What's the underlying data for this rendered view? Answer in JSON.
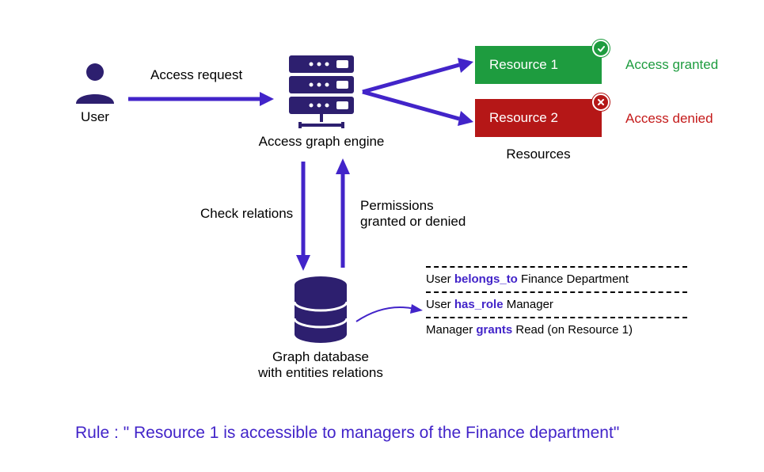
{
  "nodes": {
    "user": {
      "label": "User"
    },
    "engine": {
      "label": "Access graph engine"
    },
    "resources_group": {
      "label": "Resources"
    },
    "resource1": {
      "label": "Resource 1",
      "status": "Access granted"
    },
    "resource2": {
      "label": "Resource 2",
      "status": "Access denied"
    },
    "db": {
      "label_l1": "Graph database",
      "label_l2": "with entities relations"
    }
  },
  "edges": {
    "access_request": "Access request",
    "check_relations": "Check relations",
    "permissions_l1": "Permissions",
    "permissions_l2": "granted or denied"
  },
  "relations": {
    "r1_pre": "User ",
    "r1_kw": "belongs_to",
    "r1_post": " Finance Department",
    "r2_pre": "User ",
    "r2_kw": "has_role",
    "r2_post": " Manager",
    "r3_pre": "Manager ",
    "r3_kw": "grants",
    "r3_post": " Read (on Resource 1)"
  },
  "rule": {
    "prefix": "Rule : ",
    "text": "\" Resource 1 is accessible to managers of the Finance department\""
  },
  "colors": {
    "purple": "#4224c9",
    "green": "#1e9c3f",
    "red": "#b51717"
  }
}
